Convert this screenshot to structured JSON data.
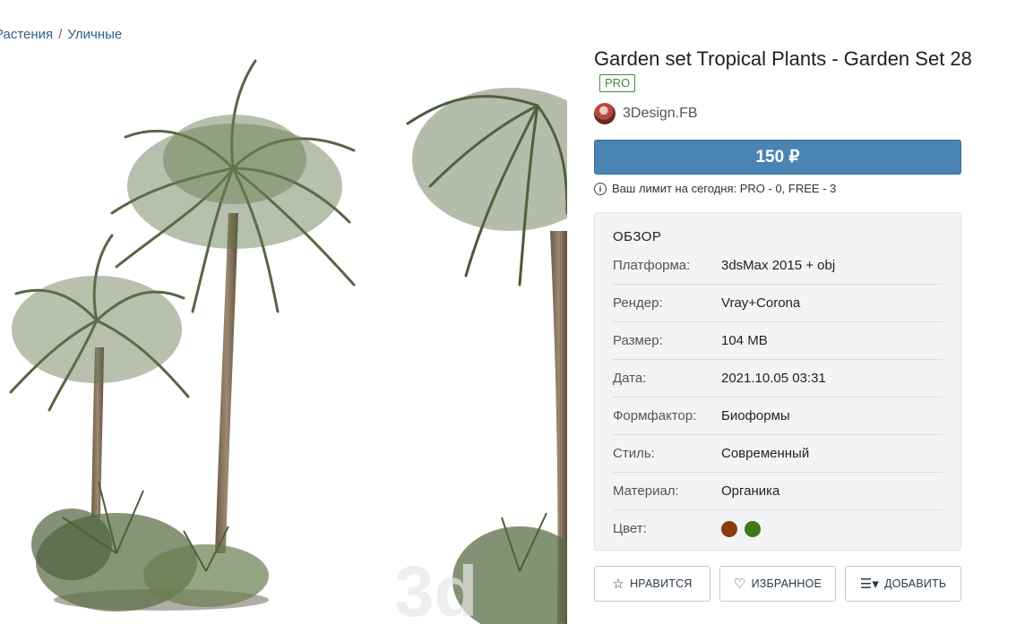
{
  "breadcrumb": {
    "items": [
      "Растения",
      "Уличные"
    ],
    "separator": "/"
  },
  "product": {
    "title": "Garden set Tropical Plants - Garden Set 28",
    "badge": "PRO",
    "author": "3Design.FB",
    "price_button": "150 ₽",
    "limit_text": "Ваш лимит на сегодня: PRO - 0, FREE - 3"
  },
  "overview": {
    "heading": "ОБЗОР",
    "rows": [
      {
        "key": "Платформа:",
        "value": "3dsMax 2015 + obj"
      },
      {
        "key": "Рендер:",
        "value": "Vray+Corona"
      },
      {
        "key": "Размер:",
        "value": "104 MB"
      },
      {
        "key": "Дата:",
        "value": "2021.10.05 03:31"
      },
      {
        "key": "Формфактор:",
        "value": "Биоформы"
      },
      {
        "key": "Стиль:",
        "value": "Современный"
      },
      {
        "key": "Материал:",
        "value": "Органика"
      },
      {
        "key": "Цвет:",
        "value": ""
      }
    ],
    "colors": [
      "#8a3c0e",
      "#3e7a16"
    ]
  },
  "actions": {
    "like": "НРАВИТСЯ",
    "favorite": "ИЗБРАННОЕ",
    "add": "ДОБАВИТЬ"
  },
  "icons": {
    "like": "star-icon",
    "favorite": "heart-icon",
    "add": "menu-add-icon",
    "info": "info-icon"
  }
}
